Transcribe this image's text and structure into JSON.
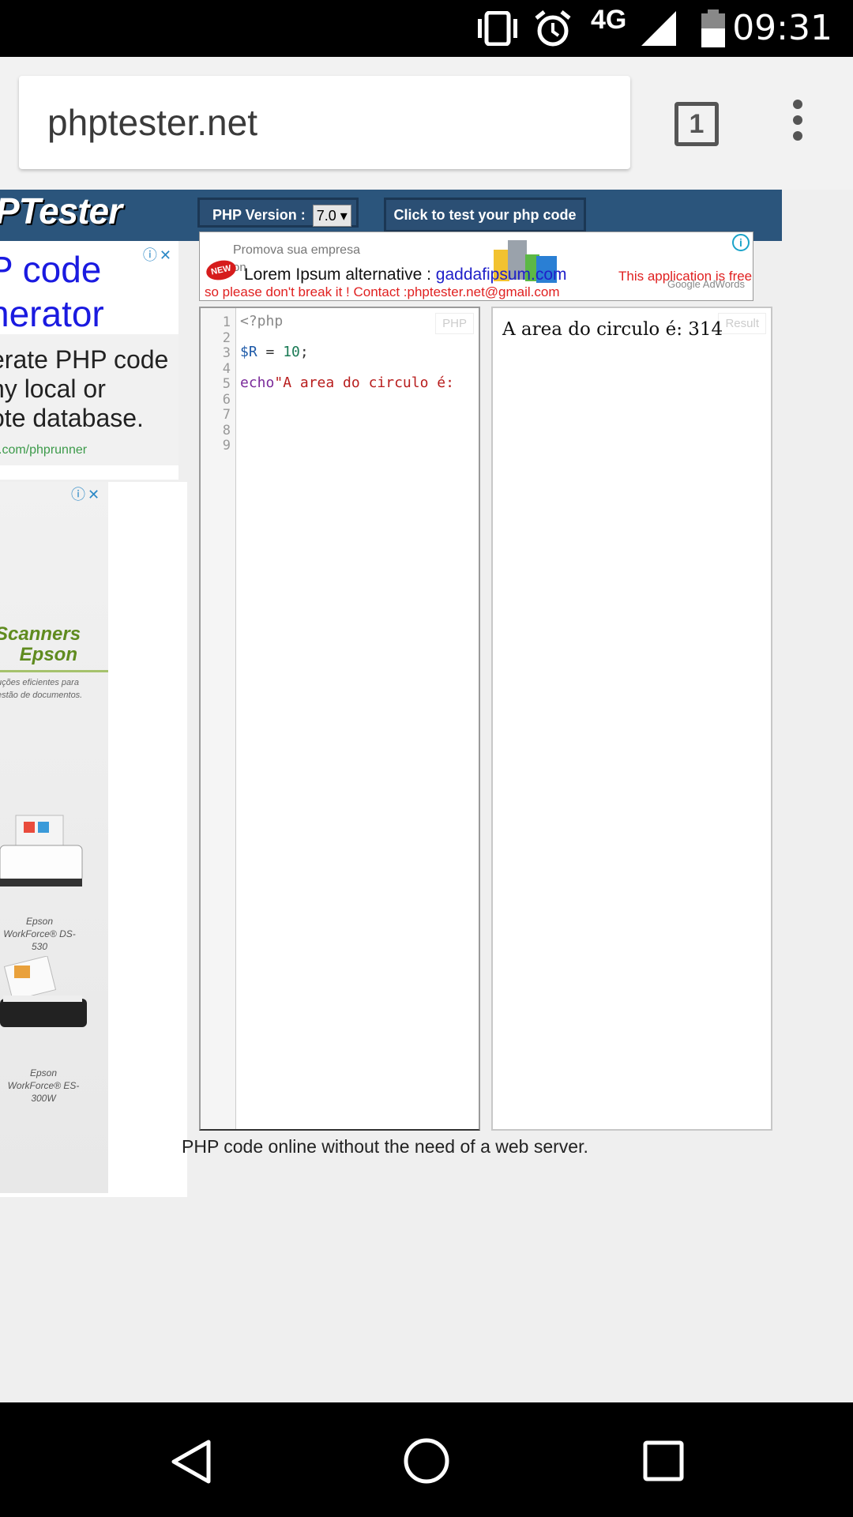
{
  "status_bar": {
    "time": "09:31",
    "network": "4G"
  },
  "browser": {
    "url": "phptester.net",
    "tab_count": "1"
  },
  "header": {
    "logo": "PTester",
    "version_label": "PHP Version :",
    "version_value": "7.0 ▾",
    "test_button": "Click to test your php code"
  },
  "notice": {
    "promo": "Promova sua empresa",
    "promo2": "on",
    "new_badge": "NEW",
    "lorem_label": "Lorem Ipsum alternative :",
    "lorem_link": "gaddafipsum.com",
    "free_text": "This application is free",
    "contact": "so please don't break it ! Contact :phptester.net@gmail.com",
    "adwords": "Google AdWords"
  },
  "ad_top": {
    "headline_1": "P code",
    "headline_2": "nerator",
    "body_1": "erate PHP code",
    "body_2": "ny local or",
    "body_3": "ote database.",
    "url": ".com/phprunner"
  },
  "ad_side": {
    "scanners": "Scanners",
    "brand": "Epson",
    "tagline_1": "uções eficientes para",
    "tagline_2": "estão de documentos.",
    "caption1_1": "Epson",
    "caption1_2": "WorkForce® DS-530",
    "caption2_1": "Epson",
    "caption2_2": "WorkForce® ES-300W"
  },
  "editor": {
    "lang_tag": "PHP",
    "line_numbers": [
      "1",
      "2",
      "3",
      "4",
      "5",
      "6",
      "7",
      "8",
      "9"
    ],
    "lines": {
      "l1": "<?php",
      "l3_var": "$R",
      "l3_op": " = ",
      "l3_num": "10",
      "l3_end": ";",
      "l5_kw": "echo",
      "l5_str": "\"A area do circulo é:"
    }
  },
  "result": {
    "tag": "Result",
    "output": "A area do circulo é: 314"
  },
  "footer": {
    "text": "PHP code online without the need of a web server."
  },
  "colors": {
    "header": "#2b557c",
    "link": "#1a1ae0",
    "alert": "#e02020",
    "var": "#1e5aa8",
    "num": "#1a7a55",
    "str": "#b81d1d",
    "kw": "#7a2a9a"
  }
}
